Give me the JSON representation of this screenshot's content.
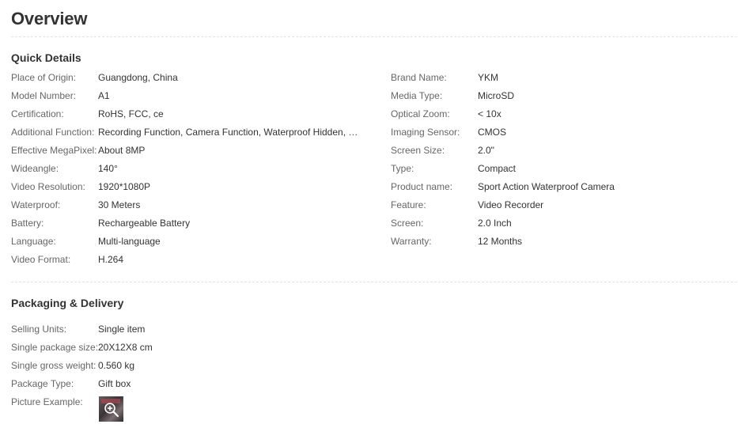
{
  "page": {
    "title": "Overview"
  },
  "quick_details": {
    "title": "Quick Details",
    "left": [
      {
        "name": "Place of Origin:",
        "value": "Guangdong, China"
      },
      {
        "name": "Model Number:",
        "value": "A1"
      },
      {
        "name": "Certification:",
        "value": "RoHS, FCC, ce"
      },
      {
        "name": "Additional Function:",
        "value": "Recording Function, Camera Function, Waterproof Hidden, Su..."
      },
      {
        "name": "Effective MegaPixel:",
        "value": "About 8MP"
      },
      {
        "name": "Wideangle:",
        "value": "140°"
      },
      {
        "name": "Video Resolution:",
        "value": "1920*1080P"
      },
      {
        "name": "Waterproof:",
        "value": "30 Meters"
      },
      {
        "name": "Battery:",
        "value": "Rechargeable Battery"
      },
      {
        "name": "Language:",
        "value": "Multi-language"
      },
      {
        "name": "Video Format:",
        "value": "H.264"
      }
    ],
    "right": [
      {
        "name": "Brand Name:",
        "value": "YKM"
      },
      {
        "name": "Media Type:",
        "value": "MicroSD"
      },
      {
        "name": "Optical Zoom:",
        "value": "< 10x"
      },
      {
        "name": "Imaging Sensor:",
        "value": "CMOS"
      },
      {
        "name": "Screen Size:",
        "value": "2.0\""
      },
      {
        "name": "Type:",
        "value": "Compact"
      },
      {
        "name": "Product name:",
        "value": "Sport Action Waterproof Camera"
      },
      {
        "name": "Feature:",
        "value": "Video Recorder"
      },
      {
        "name": "Screen:",
        "value": "2.0 Inch"
      },
      {
        "name": "Warranty:",
        "value": "12 Months"
      }
    ]
  },
  "packaging": {
    "title": "Packaging & Delivery",
    "rows": [
      {
        "name": "Selling Units:",
        "value": "Single item"
      },
      {
        "name": "Single package size:",
        "value": "20X12X8 cm"
      },
      {
        "name": "Single gross weight:",
        "value": "0.560 kg"
      },
      {
        "name": "Package Type:",
        "value": "Gift box"
      },
      {
        "name": "Picture Example:",
        "value": ""
      }
    ],
    "picture_icon": "zoom-in-icon"
  }
}
